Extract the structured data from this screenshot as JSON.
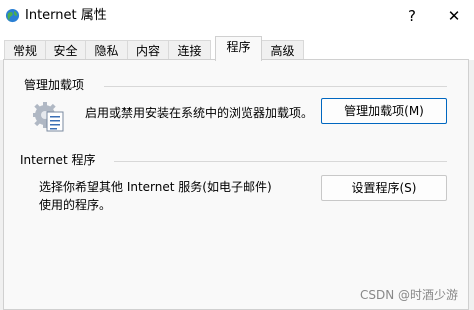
{
  "window": {
    "title": "Internet 属性",
    "help_label": "?",
    "close_label": "✕",
    "icon": "internet-globe-icon"
  },
  "tabs": [
    {
      "label": "常规",
      "active": false
    },
    {
      "label": "安全",
      "active": false
    },
    {
      "label": "隐私",
      "active": false
    },
    {
      "label": "内容",
      "active": false
    },
    {
      "label": "连接",
      "active": false
    },
    {
      "label": "程序",
      "active": true
    },
    {
      "label": "高级",
      "active": false
    }
  ],
  "addons": {
    "group_title": "管理加载项",
    "description": "启用或禁用安装在系统中的浏览器加载项。",
    "button_label": "管理加载项(M)",
    "icon": "manage-addons-icon"
  },
  "programs": {
    "group_title": "Internet 程序",
    "description_line1": "选择你希望其他 Internet 服务(如电子邮件)",
    "description_line2": "使用的程序。",
    "button_label": "设置程序(S)"
  },
  "watermark": "CSDN @时酒少游",
  "colors": {
    "focus_border": "#0067c0",
    "panel_background": "#f9f9f9",
    "window_background": "#ffffff"
  }
}
